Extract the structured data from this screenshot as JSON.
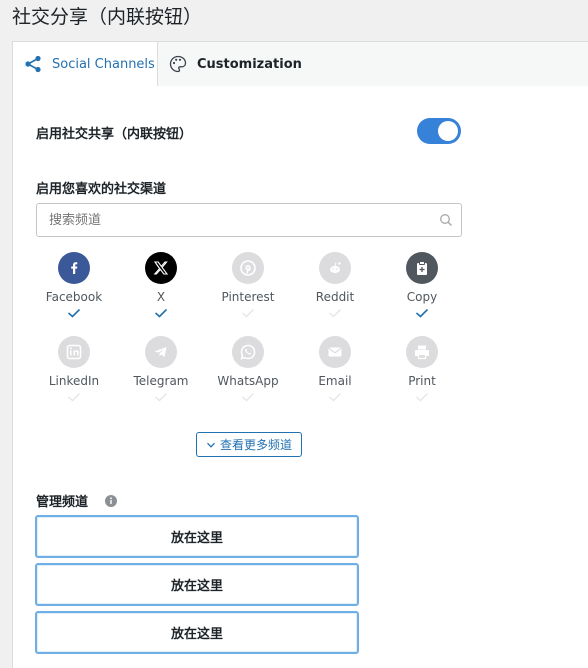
{
  "page": {
    "title": "社交分享（内联按钮）"
  },
  "tabs": [
    {
      "label": "Social Channels",
      "active": true,
      "icon": "share-icon"
    },
    {
      "label": "Customization",
      "active": false,
      "icon": "palette-icon"
    }
  ],
  "enable_sharing": {
    "label": "启用社交共享（内联按钮）",
    "on": true
  },
  "channels_section": {
    "label": "启用您喜欢的社交渠道"
  },
  "search": {
    "placeholder": "搜索频道"
  },
  "channels": [
    {
      "name": "Facebook",
      "enabled": true,
      "color": "#3b5998",
      "icon": "facebook-icon"
    },
    {
      "name": "X",
      "enabled": true,
      "color": "#000000",
      "icon": "x-icon"
    },
    {
      "name": "Pinterest",
      "enabled": false,
      "color": "#d8d8d8",
      "icon": "pinterest-icon"
    },
    {
      "name": "Reddit",
      "enabled": false,
      "color": "#d8d8d8",
      "icon": "reddit-icon"
    },
    {
      "name": "Copy",
      "enabled": true,
      "color": "#555555",
      "icon": "clipboard-icon"
    },
    {
      "name": "LinkedIn",
      "enabled": false,
      "color": "#d8d8d8",
      "icon": "linkedin-icon"
    },
    {
      "name": "Telegram",
      "enabled": false,
      "color": "#d8d8d8",
      "icon": "telegram-icon"
    },
    {
      "name": "WhatsApp",
      "enabled": false,
      "color": "#d8d8d8",
      "icon": "whatsapp-icon"
    },
    {
      "name": "Email",
      "enabled": false,
      "color": "#d8d8d8",
      "icon": "email-icon"
    },
    {
      "name": "Print",
      "enabled": false,
      "color": "#d8d8d8",
      "icon": "print-icon"
    }
  ],
  "more_button": {
    "label": "查看更多频道"
  },
  "manage": {
    "label": "管理频道"
  },
  "drop_zones": [
    {
      "label": "放在这里"
    },
    {
      "label": "放在这里"
    },
    {
      "label": "放在这里"
    }
  ],
  "colors": {
    "accent": "#2271b1",
    "toggle": "#3582d8",
    "check_on": "#2271b1",
    "check_off": "#dcdcde"
  }
}
